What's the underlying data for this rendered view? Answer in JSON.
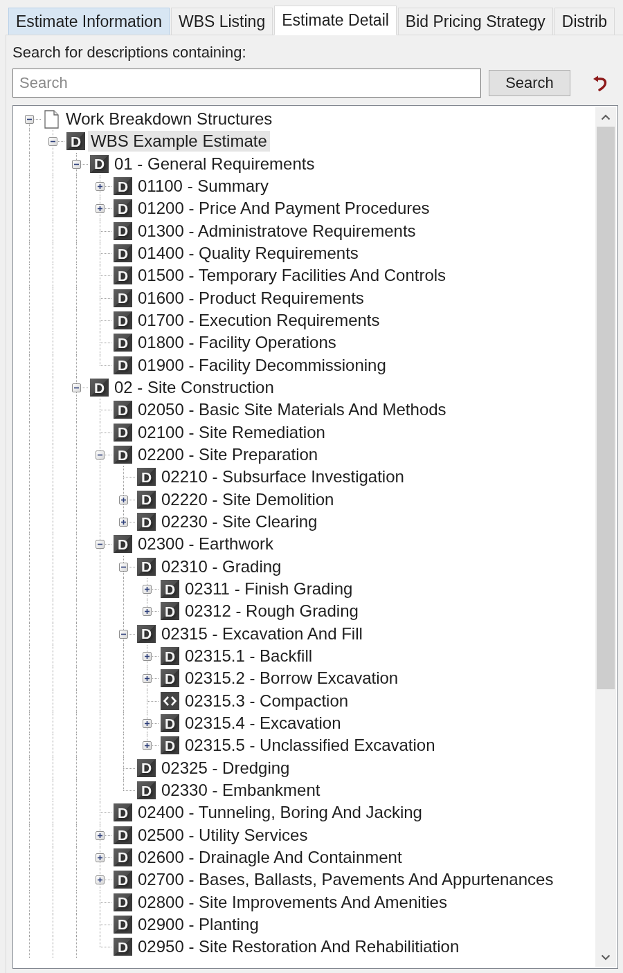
{
  "tabs": [
    {
      "label": "Estimate Information",
      "selected": false,
      "hovered": true
    },
    {
      "label": "WBS Listing",
      "selected": false,
      "hovered": false
    },
    {
      "label": "Estimate Detail",
      "selected": true,
      "hovered": false
    },
    {
      "label": "Bid Pricing Strategy",
      "selected": false,
      "hovered": false
    },
    {
      "label": "Distrib",
      "selected": false,
      "hovered": false
    }
  ],
  "search": {
    "label": "Search for descriptions containing:",
    "placeholder": "Search",
    "button": "Search"
  },
  "tree": {
    "items": [
      {
        "label": "Work Breakdown Structures",
        "kind": "document",
        "expanded": true,
        "selected": false,
        "more_below": true,
        "children": [
          {
            "label": "WBS Example Estimate",
            "kind": "division",
            "badge": "D",
            "expanded": true,
            "selected": true,
            "more_below": true,
            "children": [
              {
                "label": "01 - General Requirements",
                "kind": "division",
                "badge": "D",
                "expanded": true,
                "selected": false,
                "children": [
                  {
                    "label": "01100 - Summary",
                    "kind": "division",
                    "badge": "D",
                    "expanded": false,
                    "selected": false
                  },
                  {
                    "label": "01200 - Price And Payment Procedures",
                    "kind": "division",
                    "badge": "D",
                    "expanded": false,
                    "selected": false
                  },
                  {
                    "label": "01300 - Administratove Requirements",
                    "kind": "division",
                    "badge": "D",
                    "selected": false
                  },
                  {
                    "label": "01400 - Quality Requirements",
                    "kind": "division",
                    "badge": "D",
                    "selected": false
                  },
                  {
                    "label": "01500 - Temporary Facilities And Controls",
                    "kind": "division",
                    "badge": "D",
                    "selected": false
                  },
                  {
                    "label": "01600 - Product Requirements",
                    "kind": "division",
                    "badge": "D",
                    "selected": false
                  },
                  {
                    "label": "01700 - Execution Requirements",
                    "kind": "division",
                    "badge": "D",
                    "selected": false
                  },
                  {
                    "label": "01800 - Facility Operations",
                    "kind": "division",
                    "badge": "D",
                    "selected": false
                  },
                  {
                    "label": "01900 - Facility Decommissioning",
                    "kind": "division",
                    "badge": "D",
                    "selected": false
                  }
                ]
              },
              {
                "label": "02 - Site Construction",
                "kind": "division",
                "badge": "D",
                "expanded": true,
                "selected": false,
                "more_below": true,
                "children": [
                  {
                    "label": "02050 - Basic Site Materials And Methods",
                    "kind": "division",
                    "badge": "D",
                    "selected": false
                  },
                  {
                    "label": "02100 - Site Remediation",
                    "kind": "division",
                    "badge": "D",
                    "selected": false
                  },
                  {
                    "label": "02200 - Site Preparation",
                    "kind": "division",
                    "badge": "D",
                    "expanded": true,
                    "selected": false,
                    "children": [
                      {
                        "label": "02210 - Subsurface Investigation",
                        "kind": "division",
                        "badge": "D",
                        "selected": false
                      },
                      {
                        "label": "02220 - Site Demolition",
                        "kind": "division",
                        "badge": "D",
                        "expanded": false,
                        "selected": false
                      },
                      {
                        "label": "02230 - Site Clearing",
                        "kind": "division",
                        "badge": "D",
                        "expanded": false,
                        "selected": false
                      }
                    ]
                  },
                  {
                    "label": "02300 - Earthwork",
                    "kind": "division",
                    "badge": "D",
                    "expanded": true,
                    "selected": false,
                    "children": [
                      {
                        "label": "02310 - Grading",
                        "kind": "division",
                        "badge": "D",
                        "expanded": true,
                        "selected": false,
                        "children": [
                          {
                            "label": "02311 - Finish Grading",
                            "kind": "division",
                            "badge": "D",
                            "expanded": false,
                            "selected": false
                          },
                          {
                            "label": "02312 - Rough Grading",
                            "kind": "division",
                            "badge": "D",
                            "expanded": false,
                            "selected": false
                          }
                        ]
                      },
                      {
                        "label": "02315 - Excavation And Fill",
                        "kind": "division",
                        "badge": "D",
                        "expanded": true,
                        "selected": false,
                        "children": [
                          {
                            "label": "02315.1 - Backfill",
                            "kind": "division",
                            "badge": "D",
                            "expanded": false,
                            "selected": false
                          },
                          {
                            "label": "02315.2 - Borrow Excavation",
                            "kind": "division",
                            "badge": "D",
                            "expanded": false,
                            "selected": false
                          },
                          {
                            "label": "02315.3 - Compaction",
                            "kind": "code",
                            "selected": false
                          },
                          {
                            "label": "02315.4 - Excavation",
                            "kind": "division",
                            "badge": "D",
                            "expanded": false,
                            "selected": false
                          },
                          {
                            "label": "02315.5 - Unclassified Excavation",
                            "kind": "division",
                            "badge": "D",
                            "expanded": false,
                            "selected": false
                          }
                        ]
                      },
                      {
                        "label": "02325 - Dredging",
                        "kind": "division",
                        "badge": "D",
                        "selected": false
                      },
                      {
                        "label": "02330 - Embankment",
                        "kind": "division",
                        "badge": "D",
                        "selected": false
                      }
                    ]
                  },
                  {
                    "label": "02400 - Tunneling, Boring And Jacking",
                    "kind": "division",
                    "badge": "D",
                    "selected": false
                  },
                  {
                    "label": "02500 - Utility Services",
                    "kind": "division",
                    "badge": "D",
                    "expanded": false,
                    "selected": false
                  },
                  {
                    "label": "02600 - Drainagle And Containment",
                    "kind": "division",
                    "badge": "D",
                    "expanded": false,
                    "selected": false
                  },
                  {
                    "label": "02700 - Bases, Ballasts, Pavements And Appurtenances",
                    "kind": "division",
                    "badge": "D",
                    "expanded": false,
                    "selected": false
                  },
                  {
                    "label": "02800 - Site Improvements And Amenities",
                    "kind": "division",
                    "badge": "D",
                    "selected": false
                  },
                  {
                    "label": "02900 - Planting",
                    "kind": "division",
                    "badge": "D",
                    "selected": false
                  },
                  {
                    "label": "02950 - Site Restoration And Rehabilitiation",
                    "kind": "division",
                    "badge": "D",
                    "selected": false
                  }
                ]
              }
            ]
          }
        ]
      }
    ]
  }
}
